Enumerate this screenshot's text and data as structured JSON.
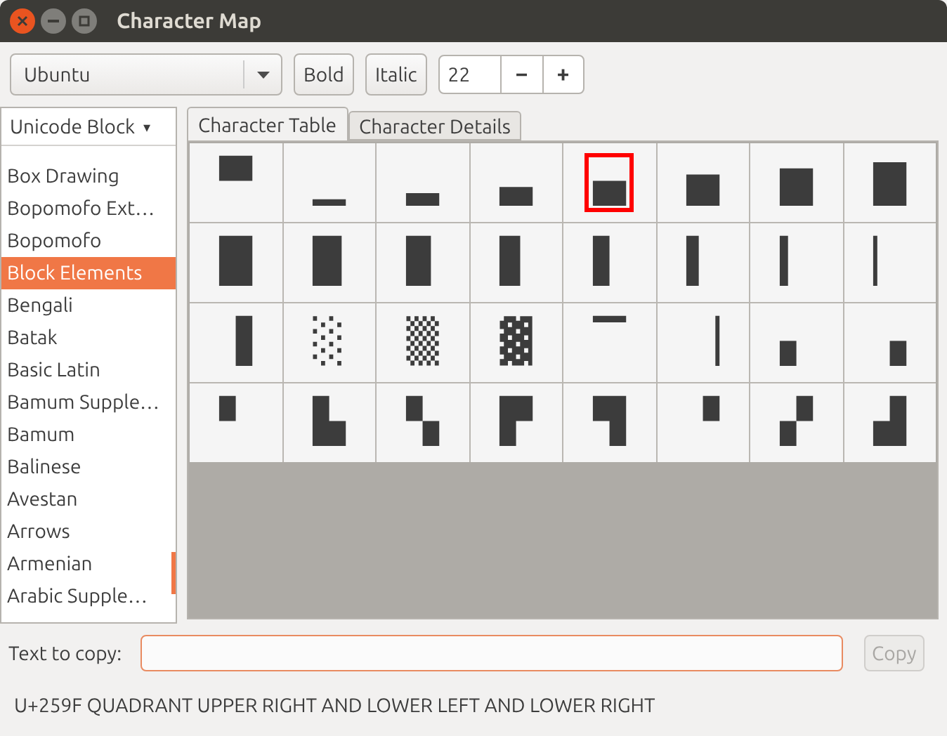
{
  "window": {
    "title": "Character Map"
  },
  "toolbar": {
    "font": "Ubuntu",
    "bold": "Bold",
    "italic": "Italic",
    "size": "22",
    "minus": "−",
    "plus": "+"
  },
  "sidebar": {
    "header": "Unicode Block",
    "header_caret": "▾",
    "items": [
      {
        "label": "Box Drawing",
        "selected": false
      },
      {
        "label": "Bopomofo Ext…",
        "selected": false
      },
      {
        "label": "Bopomofo",
        "selected": false
      },
      {
        "label": "Block Elements",
        "selected": true
      },
      {
        "label": "Bengali",
        "selected": false
      },
      {
        "label": "Batak",
        "selected": false
      },
      {
        "label": "Basic Latin",
        "selected": false
      },
      {
        "label": "Bamum Supple…",
        "selected": false
      },
      {
        "label": "Bamum",
        "selected": false
      },
      {
        "label": "Balinese",
        "selected": false
      },
      {
        "label": "Avestan",
        "selected": false
      },
      {
        "label": "Arrows",
        "selected": false
      },
      {
        "label": "Armenian",
        "selected": false
      },
      {
        "label": "Arabic Supple…",
        "selected": false
      }
    ]
  },
  "tabs": [
    {
      "label": "Character Table",
      "selected": true
    },
    {
      "label": "Character Details",
      "selected": false
    }
  ],
  "characters": [
    {
      "glyph": "▀",
      "selected": false
    },
    {
      "glyph": "▁",
      "selected": false
    },
    {
      "glyph": "▂",
      "selected": false
    },
    {
      "glyph": "▃",
      "selected": false
    },
    {
      "glyph": "▄",
      "selected": true
    },
    {
      "glyph": "▅",
      "selected": false
    },
    {
      "glyph": "▆",
      "selected": false
    },
    {
      "glyph": "▇",
      "selected": false
    },
    {
      "glyph": "█",
      "selected": false
    },
    {
      "glyph": "▉",
      "selected": false
    },
    {
      "glyph": "▊",
      "selected": false
    },
    {
      "glyph": "▋",
      "selected": false
    },
    {
      "glyph": "▌",
      "selected": false
    },
    {
      "glyph": "▍",
      "selected": false
    },
    {
      "glyph": "▎",
      "selected": false
    },
    {
      "glyph": "▏",
      "selected": false
    },
    {
      "glyph": "▐",
      "selected": false
    },
    {
      "glyph": "░",
      "selected": false
    },
    {
      "glyph": "▒",
      "selected": false
    },
    {
      "glyph": "▓",
      "selected": false
    },
    {
      "glyph": "▔",
      "selected": false
    },
    {
      "glyph": "▕",
      "selected": false
    },
    {
      "glyph": "▖",
      "selected": false
    },
    {
      "glyph": "▗",
      "selected": false
    },
    {
      "glyph": "▘",
      "selected": false
    },
    {
      "glyph": "▙",
      "selected": false
    },
    {
      "glyph": "▚",
      "selected": false
    },
    {
      "glyph": "▛",
      "selected": false
    },
    {
      "glyph": "▜",
      "selected": false
    },
    {
      "glyph": "▝",
      "selected": false
    },
    {
      "glyph": "▞",
      "selected": false
    },
    {
      "glyph": "▟",
      "selected": false
    }
  ],
  "copy": {
    "label": "Text to copy:",
    "button": "Copy",
    "button_disabled": true
  },
  "status_bar": "U+259F QUADRANT UPPER RIGHT AND LOWER LEFT AND LOWER RIGHT"
}
